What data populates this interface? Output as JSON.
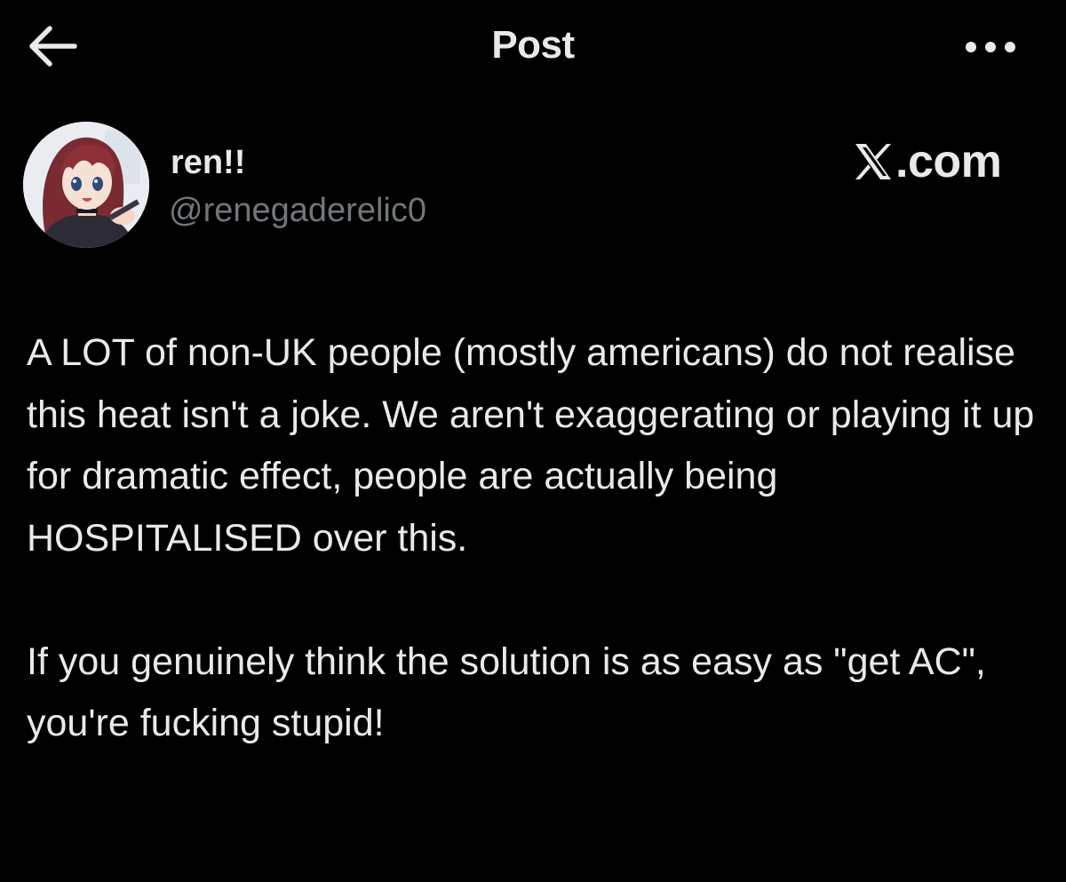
{
  "header": {
    "title": "Post",
    "back_icon": "arrow-left-icon",
    "more_icon": "more-horizontal-icon"
  },
  "author": {
    "display_name": "ren!!",
    "handle": "@renegaderelic0",
    "avatar_icon": "anime-avatar"
  },
  "watermark": {
    "logo_icon": "x-logo-icon",
    "text": ".com"
  },
  "post": {
    "paragraphs": [
      "A LOT of non-UK people (mostly americans) do not realise this heat isn't a joke. We aren't exaggerating or playing it up for dramatic effect, people are actually being HOSPITALISED over this.",
      "If you genuinely think the solution is as easy as \"get AC\", you're fucking stupid!"
    ]
  },
  "colors": {
    "background": "#000000",
    "text_primary": "#e7e9ea",
    "text_secondary": "#71767b"
  }
}
